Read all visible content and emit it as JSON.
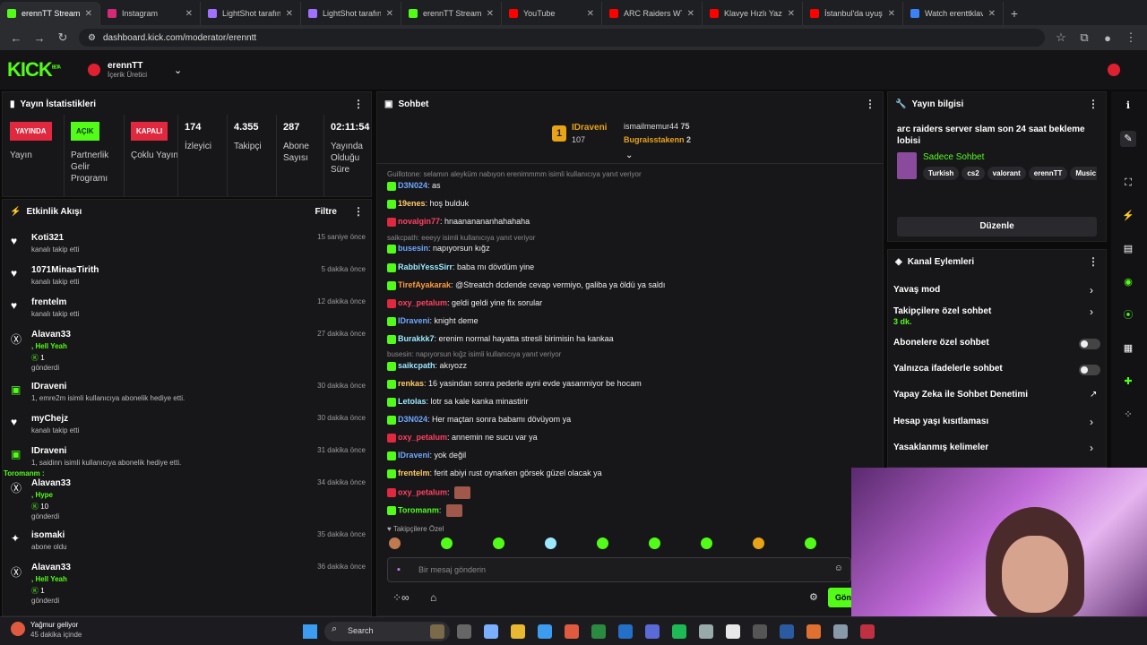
{
  "tabs": [
    {
      "label": "erennTT Stream -",
      "color": "#53fc18",
      "active": true
    },
    {
      "label": "Instagram",
      "color": "#d62976"
    },
    {
      "label": "LightShot tarafınd",
      "color": "#a070ff"
    },
    {
      "label": "LightShot tarafınd",
      "color": "#a070ff"
    },
    {
      "label": "erennTT Stream -",
      "color": "#53fc18"
    },
    {
      "label": "YouTube",
      "color": "#ff0000"
    },
    {
      "label": "ARC Raiders WTF",
      "color": "#ff0000"
    },
    {
      "label": "Klavye Hızlı Yazm",
      "color": "#ff0000"
    },
    {
      "label": "İstanbul'da uyuşt",
      "color": "#ff0000"
    },
    {
      "label": "Watch erenttklav",
      "color": "#3b82f6"
    }
  ],
  "address": {
    "url": "dashboard.kick.com/moderator/erenntt"
  },
  "header": {
    "logo": "KICK",
    "beta": "BETA",
    "username": "erennTT",
    "role": "İçerik Üretici"
  },
  "stats": {
    "title": "Yayın İstatistikleri",
    "items": [
      {
        "badge": "YAYINDA",
        "badge_color": "#e0283e",
        "label": "Yayın"
      },
      {
        "badge": "AÇIK",
        "badge_color": "#53fc18",
        "label": "Partnerlik Gelir Programı"
      },
      {
        "badge": "KAPALI",
        "badge_color": "#e0283e",
        "label": "Çoklu Yayın"
      },
      {
        "value": "174",
        "label": "İzleyici"
      },
      {
        "value": "4.355",
        "label": "Takipçi"
      },
      {
        "value": "287",
        "label": "Abone Sayısı"
      },
      {
        "value": "02:11:54",
        "label": "Yayında Olduğu Süre"
      }
    ]
  },
  "activity": {
    "title": "Etkinlik Akışı",
    "filter": "Filtre",
    "items": [
      {
        "icon": "heart",
        "name": "Koti321",
        "sub": "kanalı takip etti",
        "time": "15 saniye önce"
      },
      {
        "icon": "heart",
        "name": "1071MinasTirith",
        "sub": "kanalı takip etti",
        "time": "5 dakika önce"
      },
      {
        "icon": "heart",
        "name": "frentelm",
        "sub": "kanalı takip etti",
        "time": "12 dakika önce"
      },
      {
        "icon": "kick",
        "name": "Alavan33",
        "sub": ", Hell Yeah",
        "sub2": "1",
        "sub3": "gönderdi",
        "time": "27 dakika önce"
      },
      {
        "icon": "gift",
        "name": "IDraveni",
        "sub": "1, emre2m isimli kullanıcıya abonelik hediye etti.",
        "time": "30 dakika önce"
      },
      {
        "icon": "heart",
        "name": "myChejz",
        "sub": "kanalı takip etti",
        "time": "30 dakika önce"
      },
      {
        "icon": "gift",
        "name": "IDraveni",
        "sub": "1, saidinn isimli kullanıcıya abonelik hediye etti.",
        "time": "31 dakika önce"
      },
      {
        "icon": "kick",
        "name": "Alavan33",
        "sub": ", Hype",
        "sub2": "10",
        "sub3": "gönderdi",
        "time": "34 dakika önce"
      },
      {
        "icon": "star",
        "name": "isomaki",
        "sub": "abone oldu",
        "time": "35 dakika önce"
      },
      {
        "icon": "kick",
        "name": "Alavan33",
        "sub": ", Hell Yeah",
        "sub2": "1",
        "sub3": "gönderdi",
        "time": "36 dakika önce"
      }
    ],
    "overlay_name": "Toromanm :"
  },
  "chat": {
    "title": "Sohbet",
    "top": [
      {
        "rank": "1",
        "name": "IDraveni",
        "value": "107"
      },
      {
        "name": "ismailmemur44",
        "value": "75"
      },
      {
        "name": "Bugraisstakenn",
        "value": "2"
      }
    ],
    "messages": [
      {
        "reply": "Guillotone: selamın aleyküm nabıyon erenimmmm isimli kullanıcıya yanıt veriyor"
      },
      {
        "user": "D3N024",
        "color": "#6fa8ff",
        "text": "as"
      },
      {
        "user": "19enes",
        "color": "#ffcc66",
        "text": "hoş bulduk"
      },
      {
        "user": "novalgin77",
        "color": "#ff4060",
        "text": "hnaananananhahahaha"
      },
      {
        "reply": "saikcpath: eeeyy isimli kullanıcıya yanıt veriyor"
      },
      {
        "user": "busesin",
        "color": "#6fa8ff",
        "text": "napıyorsun kığz"
      },
      {
        "user": "RabbiYessSirr",
        "color": "#9be8ff",
        "text": "baba mı dövdüm yine"
      },
      {
        "user": "TirefAyakarak",
        "color": "#ff9b3d",
        "text": "@Streatch dcdende cevap vermiyo, galiba ya öldü ya saldı"
      },
      {
        "user": "oxy_petalum",
        "color": "#ff4060",
        "text": "geldi geldi yine fix sorular"
      },
      {
        "user": "IDraveni",
        "color": "#6fa8ff",
        "text": "knight deme"
      },
      {
        "user": "Burakkk7",
        "color": "#9be8ff",
        "text": "erenim normal hayatta stresli birimisin ha kankaa"
      },
      {
        "reply": "busesin: napıyorsun kığz isimli kullanıcıya yanıt veriyor"
      },
      {
        "user": "saikcpath",
        "color": "#9be8ff",
        "text": "akıyozz"
      },
      {
        "user": "renkas",
        "color": "#ffcc66",
        "text": "16 yasindan sonra pederle ayni evde yasanmiyor be hocam"
      },
      {
        "user": "Letolas",
        "color": "#9be8ff",
        "text": "lotr sa kale kanka minastirir"
      },
      {
        "user": "D3N024",
        "color": "#6fa8ff",
        "text": "Her maçtan sonra babamı dövüyom ya"
      },
      {
        "user": "oxy_petalum",
        "color": "#ff4060",
        "text": "annemin ne sucu var ya"
      },
      {
        "user": "IDraveni",
        "color": "#6fa8ff",
        "text": "yok değil"
      },
      {
        "user": "frentelm",
        "color": "#ffcc66",
        "text": "ferit abiyi rust oynarken görsek güzel olacak ya"
      },
      {
        "user": "oxy_petalum",
        "color": "#ff4060",
        "text": ""
      },
      {
        "user": "Toromanm",
        "color": "#53fc18",
        "text": ""
      }
    ],
    "followers_only": "Takipçilere Özel",
    "placeholder": "Bir mesaj gönderin",
    "send": "Gönder"
  },
  "stream_info": {
    "title": "Yayın bilgisi",
    "stream_title": "arc raiders server slam son 24 saat bekleme lobisi",
    "category": "Sadece Sohbet",
    "tags": [
      "Turkish",
      "cs2",
      "valorant",
      "erennTT",
      "Music"
    ],
    "edit": "Düzenle"
  },
  "channel_actions": {
    "title": "Kanal Eylemleri",
    "items": [
      {
        "label": "Yavaş mod",
        "type": "chevron"
      },
      {
        "label": "Takipçilere özel sohbet",
        "sub": "3 dk.",
        "type": "chevron"
      },
      {
        "label": "Abonelere özel sohbet",
        "type": "toggle"
      },
      {
        "label": "Yalnızca ifadelerle sohbet",
        "type": "toggle"
      },
      {
        "label": "Yapay Zeka ile Sohbet Denetimi",
        "type": "link"
      },
      {
        "label": "Hesap yaşı kısıtlaması",
        "type": "chevron"
      },
      {
        "label": "Yasaklanmış kelimeler",
        "type": "chevron"
      }
    ]
  },
  "taskbar": {
    "weather": "Yağmur geliyor",
    "weather_sub": "45 dakika içinde",
    "search": "Search"
  }
}
